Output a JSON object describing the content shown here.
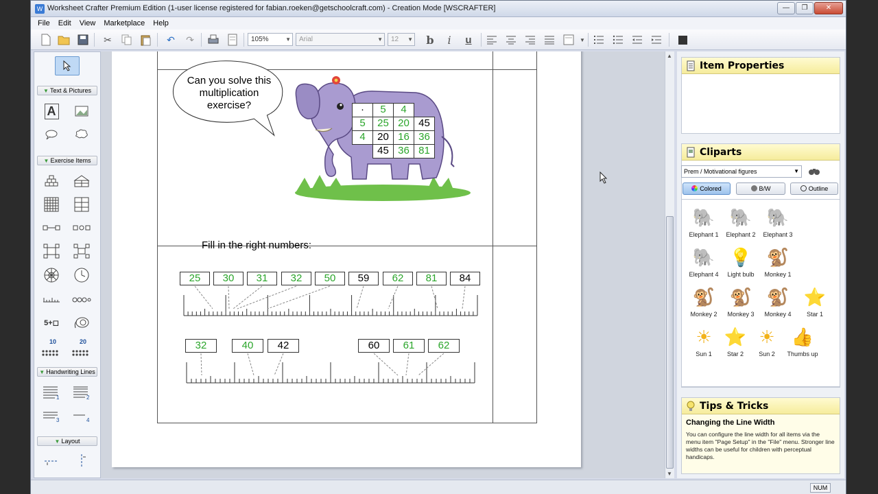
{
  "window": {
    "title": "Worksheet Crafter Premium Edition (1-user license registered for fabian.roeken@getschoolcraft.com) - Creation Mode [WSCRAFTER]",
    "controls": [
      "—",
      "❐",
      "✕"
    ]
  },
  "menu": [
    "File",
    "Edit",
    "View",
    "Marketplace",
    "Help"
  ],
  "toolbar": {
    "zoom": "105%",
    "font": "Arial",
    "size": "12",
    "bold": "b",
    "italic": "i",
    "underline": "u"
  },
  "left_panel": {
    "sections": [
      "Text & Pictures",
      "Exercise Items",
      "Handwriting Lines",
      "Layout"
    ],
    "labels_numbers": [
      "10",
      "20"
    ],
    "stepper_label": "5+◻",
    "hw_numbers": [
      "1",
      "2",
      "3",
      "4"
    ]
  },
  "worksheet": {
    "speech": "Can you solve this multiplication exercise?",
    "table": {
      "header": [
        "·",
        "5",
        "4"
      ],
      "rows": [
        [
          "5",
          "25",
          "20",
          "45"
        ],
        [
          "4",
          "20",
          "16",
          "36"
        ],
        [
          "",
          "45",
          "36",
          "81"
        ]
      ],
      "green": [
        [
          false,
          true,
          true
        ],
        [
          true,
          true,
          true,
          false
        ],
        [
          true,
          false,
          true,
          true
        ],
        [
          false,
          false,
          true,
          true
        ]
      ]
    },
    "fill_label": "Fill in the right numbers:",
    "row1": [
      {
        "v": "25",
        "g": true
      },
      {
        "v": "30",
        "g": true
      },
      {
        "v": "31",
        "g": true
      },
      {
        "v": "32",
        "g": true
      },
      {
        "v": "50",
        "g": true
      },
      {
        "v": "59",
        "g": false
      },
      {
        "v": "62",
        "g": true
      },
      {
        "v": "81",
        "g": true
      },
      {
        "v": "84",
        "g": false
      }
    ],
    "row2": [
      {
        "v": "32",
        "g": true
      },
      {
        "v": "40",
        "g": true
      },
      {
        "v": "42",
        "g": false
      },
      {
        "v": "60",
        "g": false
      },
      {
        "v": "61",
        "g": true
      },
      {
        "v": "62",
        "g": true
      }
    ]
  },
  "right_panel": {
    "item_properties": "Item Properties",
    "cliparts": "Cliparts",
    "category": "Prem / Motivational figures",
    "modes": [
      "Colored",
      "B/W",
      "Outline"
    ],
    "items": [
      {
        "label": "Elephant 1",
        "icon": "elephant"
      },
      {
        "label": "Elephant 2",
        "icon": "elephant"
      },
      {
        "label": "Elephant 3",
        "icon": "elephant"
      },
      {
        "label": "Elephant 4",
        "icon": "elephant"
      },
      {
        "label": "Light bulb",
        "icon": "bulb"
      },
      {
        "label": "Monkey 1",
        "icon": "monkey"
      },
      {
        "label": "Monkey 2",
        "icon": "monkey"
      },
      {
        "label": "Monkey 3",
        "icon": "monkey"
      },
      {
        "label": "Monkey 4",
        "icon": "monkey"
      },
      {
        "label": "Star 1",
        "icon": "star"
      },
      {
        "label": "Sun 1",
        "icon": "sun"
      },
      {
        "label": "Star 2",
        "icon": "star"
      },
      {
        "label": "Sun 2",
        "icon": "sun"
      },
      {
        "label": "Thumbs up",
        "icon": "thumbs"
      }
    ],
    "tips_title": "Tips & Tricks",
    "tip_heading": "Changing the Line Width",
    "tip_text": "You can configure the line width for all items via the menu item \"Page Setup\" in the \"File\" menu. Stronger line widths can be useful for children with perceptual handicaps."
  },
  "status": {
    "num": "NUM"
  },
  "colors": {
    "green": "#2aa52a",
    "accent_yellow": "#f6ec9c",
    "elephant": "#a99bd0"
  }
}
